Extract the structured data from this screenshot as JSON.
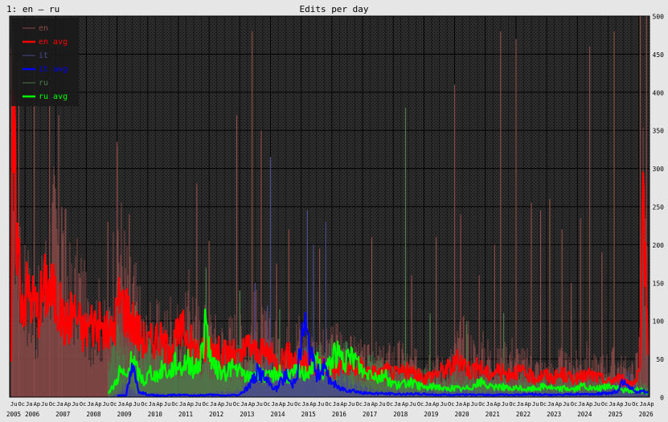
{
  "header": {
    "panel_label": "1: en – ru",
    "title": "Edits per day"
  },
  "chart_data": {
    "type": "line",
    "title": "Edits per day",
    "xlabel": "",
    "ylabel": "",
    "xlim": [
      2005.5,
      2026.35
    ],
    "ylim": [
      0,
      500
    ],
    "yticks": [
      0,
      50,
      100,
      150,
      200,
      250,
      300,
      350,
      400,
      450,
      500
    ],
    "y_axis_side": "right",
    "grid": true,
    "legend_position": "top-left",
    "year_labels": [
      "2005",
      "2006",
      "2007",
      "2008",
      "2009",
      "2010",
      "2011",
      "2012",
      "2013",
      "2014",
      "2015",
      "2016",
      "2017",
      "2018",
      "2019",
      "2020",
      "2021",
      "2022",
      "2023",
      "2024",
      "2025",
      "2026"
    ],
    "month_tick_labels": [
      "Ja",
      "Ap",
      "Ju",
      "Oc"
    ],
    "colors": {
      "plot_background": "#2b2b2b",
      "page_background": "#e6e6e6",
      "grid": "#000000",
      "en": "#8a4a48",
      "en_avg": "#ff0000",
      "it": "#4a4a8c",
      "it_avg": "#0000ff",
      "ru": "#4a7a4a",
      "ru_avg": "#00ff00"
    },
    "series": [
      {
        "name": "en",
        "x": [
          2005.55,
          2005.7,
          2005.85,
          2006.0,
          2006.3,
          2006.6,
          2006.9,
          2007.2,
          2007.5,
          2007.8,
          2008.1,
          2008.4,
          2008.7,
          2009.0,
          2009.3,
          2009.6,
          2009.9,
          2010.2,
          2010.5,
          2010.8,
          2011.1,
          2011.4,
          2011.7,
          2012.0,
          2012.3,
          2012.6,
          2012.9,
          2013.2,
          2013.5,
          2013.8,
          2014.1,
          2014.4,
          2014.7,
          2015.0,
          2015.3,
          2015.6,
          2015.9,
          2016.2,
          2016.5,
          2016.8,
          2017.1,
          2017.4,
          2017.7,
          2018.0,
          2018.3,
          2018.6,
          2018.9,
          2019.2,
          2019.5,
          2019.8,
          2020.1,
          2020.4,
          2020.7,
          2021.0,
          2021.3,
          2021.6,
          2021.9,
          2022.2,
          2022.5,
          2022.8,
          2023.1,
          2023.4,
          2023.7,
          2024.0,
          2024.3,
          2024.6,
          2024.9,
          2025.2,
          2025.5,
          2025.8,
          2026.0,
          2026.15,
          2026.3
        ],
        "values": [
          400,
          300,
          180,
          200,
          110,
          170,
          260,
          240,
          160,
          175,
          110,
          130,
          90,
          270,
          180,
          150,
          95,
          110,
          95,
          125,
          80,
          150,
          95,
          110,
          85,
          90,
          100,
          80,
          120,
          95,
          90,
          75,
          85,
          100,
          80,
          70,
          75,
          90,
          65,
          70,
          55,
          60,
          55,
          65,
          60,
          50,
          55,
          60,
          45,
          50,
          80,
          95,
          60,
          75,
          50,
          60,
          70,
          55,
          50,
          45,
          40,
          55,
          45,
          50,
          60,
          45,
          50,
          55,
          45,
          40,
          60,
          340,
          120
        ],
        "peaks": [
          [
            2005.6,
            480
          ],
          [
            2005.8,
            440
          ],
          [
            2006.3,
            435
          ],
          [
            2006.8,
            410
          ],
          [
            2007.1,
            370
          ],
          [
            2007.2,
            250
          ],
          [
            2008.7,
            230
          ],
          [
            2009.0,
            335
          ],
          [
            2009.4,
            240
          ],
          [
            2011.6,
            280
          ],
          [
            2012.0,
            205
          ],
          [
            2012.9,
            370
          ],
          [
            2013.4,
            480
          ],
          [
            2013.7,
            350
          ],
          [
            2014.2,
            175
          ],
          [
            2014.6,
            220
          ],
          [
            2015.6,
            195
          ],
          [
            2017.3,
            210
          ],
          [
            2018.6,
            160
          ],
          [
            2019.4,
            210
          ],
          [
            2020.0,
            410
          ],
          [
            2020.2,
            240
          ],
          [
            2020.8,
            160
          ],
          [
            2021.3,
            200
          ],
          [
            2021.5,
            480
          ],
          [
            2022.0,
            470
          ],
          [
            2022.5,
            255
          ],
          [
            2022.8,
            245
          ],
          [
            2023.1,
            260
          ],
          [
            2023.5,
            220
          ],
          [
            2023.8,
            150
          ],
          [
            2024.1,
            235
          ],
          [
            2024.4,
            460
          ],
          [
            2024.8,
            190
          ],
          [
            2025.2,
            480
          ],
          [
            2026.05,
            500
          ],
          [
            2026.25,
            500
          ]
        ]
      },
      {
        "name": "en avg",
        "x": [
          2005.55,
          2005.6,
          2005.75,
          2005.9,
          2006.1,
          2006.4,
          2006.7,
          2007.0,
          2007.3,
          2007.6,
          2007.9,
          2008.2,
          2008.5,
          2008.8,
          2009.1,
          2009.4,
          2009.7,
          2010.0,
          2010.3,
          2010.6,
          2010.9,
          2011.2,
          2011.5,
          2011.8,
          2012.1,
          2012.4,
          2012.7,
          2013.0,
          2013.3,
          2013.6,
          2013.9,
          2014.2,
          2014.5,
          2014.8,
          2015.1,
          2015.4,
          2015.7,
          2016.0,
          2016.3,
          2016.6,
          2016.9,
          2017.2,
          2017.5,
          2017.8,
          2018.1,
          2018.4,
          2018.7,
          2019.0,
          2019.3,
          2019.6,
          2019.9,
          2020.2,
          2020.5,
          2020.8,
          2021.1,
          2021.4,
          2021.7,
          2022.0,
          2022.3,
          2022.6,
          2022.9,
          2023.2,
          2023.5,
          2023.8,
          2024.1,
          2024.4,
          2024.7,
          2025.0,
          2025.3,
          2025.6,
          2025.9,
          2026.05,
          2026.15,
          2026.3
        ],
        "values": [
          20,
          360,
          210,
          130,
          140,
          115,
          150,
          130,
          95,
          115,
          85,
          100,
          90,
          80,
          130,
          110,
          85,
          70,
          80,
          65,
          75,
          90,
          65,
          60,
          70,
          55,
          60,
          50,
          70,
          55,
          60,
          45,
          55,
          50,
          45,
          40,
          45,
          35,
          40,
          35,
          40,
          35,
          30,
          35,
          30,
          35,
          30,
          25,
          30,
          35,
          40,
          50,
          35,
          40,
          30,
          35,
          30,
          35,
          30,
          25,
          30,
          25,
          30,
          25,
          25,
          30,
          25,
          20,
          25,
          20,
          20,
          35,
          260,
          80
        ]
      },
      {
        "name": "it",
        "x": [
          2008.7,
          2009.0,
          2009.3,
          2009.6,
          2010.0,
          2010.5,
          2011.0,
          2011.5,
          2012.0,
          2012.5,
          2013.0,
          2013.3,
          2013.6,
          2013.9,
          2014.2,
          2014.5,
          2014.8,
          2015.1,
          2015.4,
          2015.7,
          2016.0,
          2016.3,
          2016.6,
          2017.0,
          2017.5,
          2018.0,
          2018.5,
          2019.0,
          2019.5,
          2020.0,
          2020.5,
          2021.0,
          2021.5,
          2022.0,
          2022.5,
          2023.0,
          2023.5,
          2024.0,
          2024.5,
          2025.0,
          2025.4,
          2025.7,
          2026.0,
          2026.3
        ],
        "values": [
          0,
          5,
          20,
          8,
          5,
          5,
          5,
          5,
          5,
          8,
          10,
          25,
          45,
          30,
          25,
          50,
          35,
          60,
          40,
          45,
          30,
          35,
          20,
          15,
          10,
          8,
          8,
          8,
          8,
          8,
          10,
          8,
          8,
          8,
          8,
          8,
          8,
          8,
          10,
          15,
          20,
          30,
          10,
          5
        ],
        "peaks": [
          [
            2013.5,
            150
          ],
          [
            2014.0,
            315
          ],
          [
            2015.2,
            245
          ],
          [
            2015.8,
            230
          ],
          [
            2015.4,
            200
          ],
          [
            2013.9,
            120
          ]
        ]
      },
      {
        "name": "it avg",
        "x": [
          2009.0,
          2009.3,
          2009.5,
          2009.7,
          2010.0,
          2010.5,
          2011.0,
          2011.5,
          2012.0,
          2012.5,
          2013.0,
          2013.3,
          2013.6,
          2013.9,
          2014.2,
          2014.5,
          2014.7,
          2014.9,
          2015.1,
          2015.3,
          2015.5,
          2015.7,
          2015.9,
          2016.2,
          2016.5,
          2016.8,
          2017.0,
          2017.5,
          2018.0,
          2018.5,
          2019.0,
          2019.5,
          2020.0,
          2020.5,
          2021.0,
          2021.5,
          2022.0,
          2022.5,
          2023.0,
          2023.5,
          2024.0,
          2024.5,
          2025.0,
          2025.3,
          2025.5,
          2025.7,
          2025.9,
          2026.1,
          2026.3
        ],
        "values": [
          2,
          3,
          40,
          8,
          3,
          2,
          3,
          2,
          3,
          2,
          3,
          15,
          35,
          20,
          10,
          30,
          15,
          40,
          100,
          55,
          30,
          40,
          25,
          12,
          10,
          8,
          5,
          5,
          4,
          4,
          4,
          3,
          3,
          3,
          3,
          3,
          3,
          4,
          3,
          3,
          4,
          4,
          5,
          8,
          25,
          15,
          5,
          8,
          6
        ]
      },
      {
        "name": "ru",
        "x": [
          2008.7,
          2009.0,
          2009.3,
          2009.6,
          2009.9,
          2010.2,
          2010.5,
          2010.8,
          2011.1,
          2011.4,
          2011.7,
          2012.0,
          2012.3,
          2012.6,
          2012.9,
          2013.2,
          2013.5,
          2013.8,
          2014.1,
          2014.4,
          2014.7,
          2015.0,
          2015.3,
          2015.6,
          2015.9,
          2016.2,
          2016.5,
          2016.8,
          2017.1,
          2017.4,
          2017.7,
          2018.0,
          2018.3,
          2018.6,
          2018.9,
          2019.2,
          2019.5,
          2019.8,
          2020.1,
          2020.4,
          2020.7,
          2021.0,
          2021.3,
          2021.6,
          2021.9,
          2022.2,
          2022.5,
          2022.8,
          2023.1,
          2023.4,
          2023.7,
          2024.0,
          2024.3,
          2024.6,
          2024.9,
          2025.2,
          2025.5,
          2025.8,
          2026.1,
          2026.3
        ],
        "values": [
          40,
          80,
          60,
          50,
          70,
          55,
          65,
          60,
          70,
          80,
          55,
          60,
          50,
          55,
          60,
          45,
          50,
          55,
          45,
          50,
          45,
          55,
          50,
          60,
          65,
          55,
          60,
          50,
          45,
          50,
          40,
          35,
          40,
          35,
          30,
          35,
          30,
          25,
          30,
          25,
          30,
          25,
          30,
          25,
          20,
          25,
          20,
          25,
          20,
          25,
          20,
          25,
          20,
          20,
          25,
          20,
          20,
          25,
          20,
          15
        ],
        "peaks": [
          [
            2009.6,
            120
          ],
          [
            2010.9,
            100
          ],
          [
            2011.9,
            170
          ],
          [
            2013.0,
            140
          ],
          [
            2014.3,
            115
          ],
          [
            2018.4,
            380
          ],
          [
            2019.2,
            110
          ],
          [
            2020.4,
            100
          ],
          [
            2021.6,
            110
          ]
        ]
      },
      {
        "name": "ru avg",
        "x": [
          2008.7,
          2008.9,
          2009.1,
          2009.3,
          2009.5,
          2009.7,
          2009.9,
          2010.1,
          2010.3,
          2010.5,
          2010.7,
          2010.9,
          2011.1,
          2011.3,
          2011.5,
          2011.7,
          2011.9,
          2012.1,
          2012.3,
          2012.5,
          2012.7,
          2012.9,
          2013.1,
          2013.3,
          2013.5,
          2013.7,
          2013.9,
          2014.1,
          2014.3,
          2014.5,
          2014.7,
          2014.9,
          2015.1,
          2015.3,
          2015.5,
          2015.7,
          2015.9,
          2016.1,
          2016.3,
          2016.5,
          2016.7,
          2016.9,
          2017.1,
          2017.3,
          2017.5,
          2017.7,
          2017.9,
          2018.2,
          2018.5,
          2018.8,
          2019.1,
          2019.4,
          2019.7,
          2020.0,
          2020.3,
          2020.6,
          2020.9,
          2021.2,
          2021.5,
          2021.8,
          2022.1,
          2022.4,
          2022.7,
          2023.0,
          2023.3,
          2023.6,
          2023.9,
          2024.2,
          2024.5,
          2024.8,
          2025.1,
          2025.4,
          2025.7,
          2026.0,
          2026.3
        ],
        "values": [
          5,
          15,
          35,
          25,
          50,
          30,
          20,
          35,
          25,
          40,
          30,
          45,
          40,
          50,
          35,
          45,
          95,
          40,
          35,
          30,
          40,
          35,
          30,
          25,
          35,
          30,
          25,
          30,
          35,
          25,
          30,
          35,
          30,
          40,
          45,
          35,
          40,
          60,
          50,
          45,
          55,
          40,
          30,
          35,
          25,
          30,
          20,
          15,
          20,
          15,
          12,
          15,
          10,
          12,
          10,
          15,
          20,
          12,
          15,
          10,
          12,
          10,
          12,
          15,
          10,
          12,
          10,
          15,
          10,
          12,
          15,
          10,
          8,
          10,
          6
        ]
      }
    ]
  }
}
